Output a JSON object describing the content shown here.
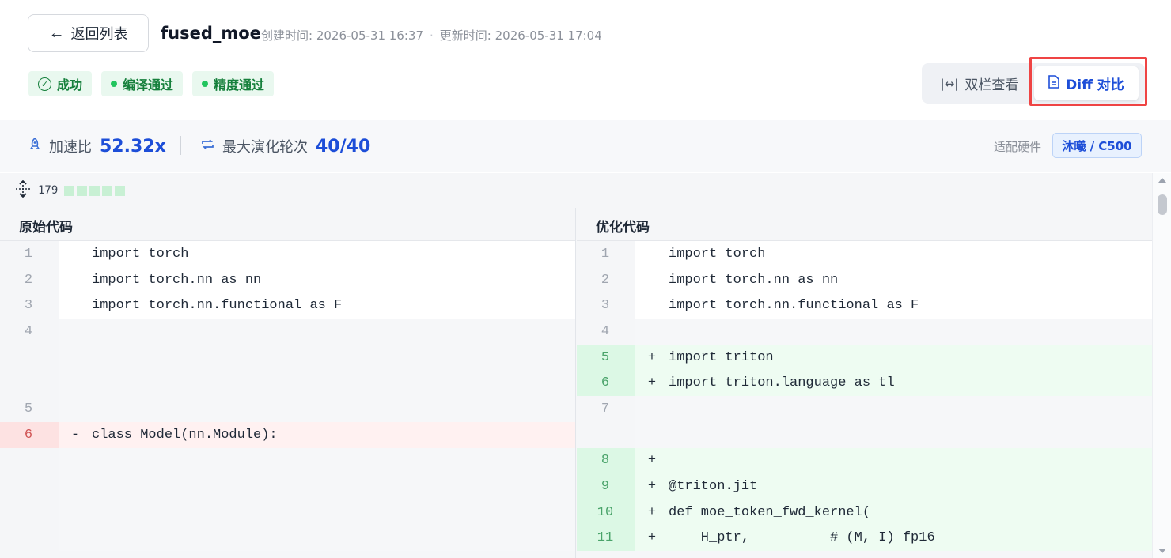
{
  "header": {
    "back_label": "返回列表",
    "title": "fused_moe",
    "created": "创建时间: 2026-05-31 16:37",
    "separator": "·",
    "updated": "更新时间: 2026-05-31 17:04",
    "badges": [
      "成功",
      "编译通过",
      "精度通过"
    ],
    "view_dual": "双栏查看",
    "view_diff": "Diff 对比"
  },
  "stats": {
    "speedup_label": "加速比",
    "speedup_value": "52.32x",
    "rounds_label": "最大演化轮次",
    "rounds_value": "40/40",
    "hardware_label": "适配硬件",
    "hardware_value": "沐曦 / C500"
  },
  "diff": {
    "hidden_lines": "179",
    "left_title": "原始代码",
    "right_title": "优化代码",
    "left": [
      {
        "kind": "ctx",
        "ln": "1",
        "sign": "",
        "code": "import torch"
      },
      {
        "kind": "ctx",
        "ln": "2",
        "sign": "",
        "code": "import torch.nn as nn"
      },
      {
        "kind": "ctx",
        "ln": "3",
        "sign": "",
        "code": "import torch.nn.functional as F"
      },
      {
        "kind": "empty",
        "ln": "4",
        "sign": "",
        "code": ""
      },
      {
        "kind": "empty",
        "ln": "",
        "sign": "",
        "code": ""
      },
      {
        "kind": "empty",
        "ln": "",
        "sign": "",
        "code": ""
      },
      {
        "kind": "empty",
        "ln": "5",
        "sign": "",
        "code": ""
      },
      {
        "kind": "del",
        "ln": "6",
        "sign": "-",
        "code": "class Model(nn.Module):"
      },
      {
        "kind": "empty",
        "ln": "",
        "sign": "",
        "code": ""
      },
      {
        "kind": "empty",
        "ln": "",
        "sign": "",
        "code": ""
      },
      {
        "kind": "empty",
        "ln": "",
        "sign": "",
        "code": ""
      },
      {
        "kind": "empty",
        "ln": "",
        "sign": "",
        "code": ""
      }
    ],
    "right": [
      {
        "kind": "ctx",
        "ln": "1",
        "sign": "",
        "code": "import torch"
      },
      {
        "kind": "ctx",
        "ln": "2",
        "sign": "",
        "code": "import torch.nn as nn"
      },
      {
        "kind": "ctx",
        "ln": "3",
        "sign": "",
        "code": "import torch.nn.functional as F"
      },
      {
        "kind": "empty",
        "ln": "4",
        "sign": "",
        "code": ""
      },
      {
        "kind": "add",
        "ln": "5",
        "sign": "+",
        "code": "import triton"
      },
      {
        "kind": "add",
        "ln": "6",
        "sign": "+",
        "code": "import triton.language as tl"
      },
      {
        "kind": "empty",
        "ln": "7",
        "sign": "",
        "code": ""
      },
      {
        "kind": "empty",
        "ln": "",
        "sign": "",
        "code": ""
      },
      {
        "kind": "add",
        "ln": "8",
        "sign": "+",
        "code": ""
      },
      {
        "kind": "add",
        "ln": "9",
        "sign": "+",
        "code": "@triton.jit"
      },
      {
        "kind": "add",
        "ln": "10",
        "sign": "+",
        "code": "def moe_token_fwd_kernel("
      },
      {
        "kind": "add",
        "ln": "11",
        "sign": "+",
        "code": "    H_ptr,          # (M, I) fp16"
      }
    ]
  },
  "colors": {
    "accent": "#1d4ed8",
    "success": "#16803c",
    "add_bg": "#eefcf2",
    "del_bg": "#fff1f1",
    "highlight": "#ef4444"
  }
}
